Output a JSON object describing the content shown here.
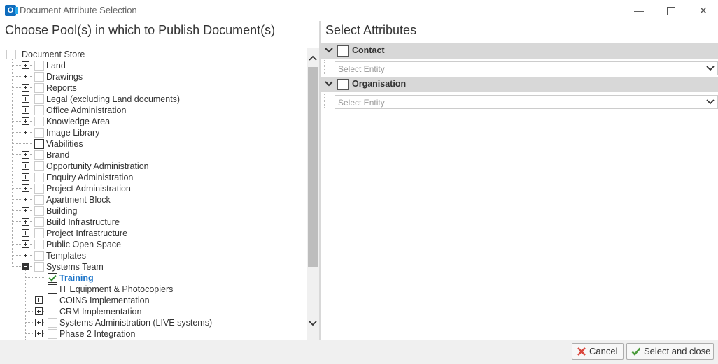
{
  "window": {
    "title": "Document Attribute Selection",
    "app_icon_letter": "O",
    "minimize": "—",
    "close": "✕"
  },
  "left_panel": {
    "title": "Choose Pool(s) in which to Publish Document(s)",
    "root": {
      "label": "Document Store",
      "checked": false
    },
    "items": [
      {
        "label": "Land",
        "expander": "plus",
        "checked": false,
        "level": 1
      },
      {
        "label": "Drawings",
        "expander": "plus",
        "checked": false,
        "level": 1
      },
      {
        "label": "Reports",
        "expander": "plus",
        "checked": false,
        "level": 1
      },
      {
        "label": "Legal (excluding Land documents)",
        "expander": "plus",
        "checked": false,
        "level": 1
      },
      {
        "label": "Office Administration",
        "expander": "plus",
        "checked": false,
        "level": 1
      },
      {
        "label": "Knowledge Area",
        "expander": "plus",
        "checked": false,
        "level": 1
      },
      {
        "label": "Image Library",
        "expander": "plus",
        "checked": false,
        "level": 1
      },
      {
        "label": "Viabilities",
        "expander": "none",
        "checked": false,
        "level": 1,
        "dark_box": true
      },
      {
        "label": "Brand",
        "expander": "plus",
        "checked": false,
        "level": 1
      },
      {
        "label": "Opportunity Administration",
        "expander": "plus",
        "checked": false,
        "level": 1
      },
      {
        "label": "Enquiry Administration",
        "expander": "plus",
        "checked": false,
        "level": 1
      },
      {
        "label": "Project Administration",
        "expander": "plus",
        "checked": false,
        "level": 1
      },
      {
        "label": "Apartment Block",
        "expander": "plus",
        "checked": false,
        "level": 1
      },
      {
        "label": "Building",
        "expander": "plus",
        "checked": false,
        "level": 1
      },
      {
        "label": "Build Infrastructure",
        "expander": "plus",
        "checked": false,
        "level": 1
      },
      {
        "label": "Project Infrastructure",
        "expander": "plus",
        "checked": false,
        "level": 1
      },
      {
        "label": "Public Open Space",
        "expander": "plus",
        "checked": false,
        "level": 1
      },
      {
        "label": "Templates",
        "expander": "plus",
        "checked": false,
        "level": 1
      },
      {
        "label": "Systems Team",
        "expander": "minus",
        "checked": false,
        "level": 1
      },
      {
        "label": "Training",
        "expander": "none",
        "checked": true,
        "level": 2,
        "selected": true
      },
      {
        "label": "IT Equipment & Photocopiers",
        "expander": "none",
        "checked": false,
        "level": 2,
        "dark_box": true
      },
      {
        "label": "COINS Implementation",
        "expander": "plus",
        "checked": false,
        "level": 2
      },
      {
        "label": "CRM Implementation",
        "expander": "plus",
        "checked": false,
        "level": 2
      },
      {
        "label": "Systems Administration (LIVE systems)",
        "expander": "plus",
        "checked": false,
        "level": 2
      },
      {
        "label": "Phase 2 Integration",
        "expander": "plus",
        "checked": false,
        "level": 2
      }
    ],
    "scroll_position": 0.1
  },
  "right_panel": {
    "title": "Select Attributes",
    "attributes": [
      {
        "label": "Contact",
        "placeholder": "Select Entity",
        "checked": false
      },
      {
        "label": "Organisation",
        "placeholder": "Select Entity",
        "checked": false
      }
    ]
  },
  "buttons": {
    "cancel": "Cancel",
    "select_and_close": "Select and close"
  },
  "colors": {
    "selected_text": "#1a73c8",
    "check_mark": "#2e8b2e",
    "cancel_icon": "#d9443a",
    "header_bg": "#d8d8d8",
    "app_icon": "#0f6cbd"
  },
  "icons": {
    "app": "outlook-icon",
    "expand": "plus-box-icon",
    "collapse": "minus-box-icon",
    "dropdown": "chevron-down-icon",
    "cancel": "red-x-icon",
    "confirm": "green-check-icon"
  }
}
